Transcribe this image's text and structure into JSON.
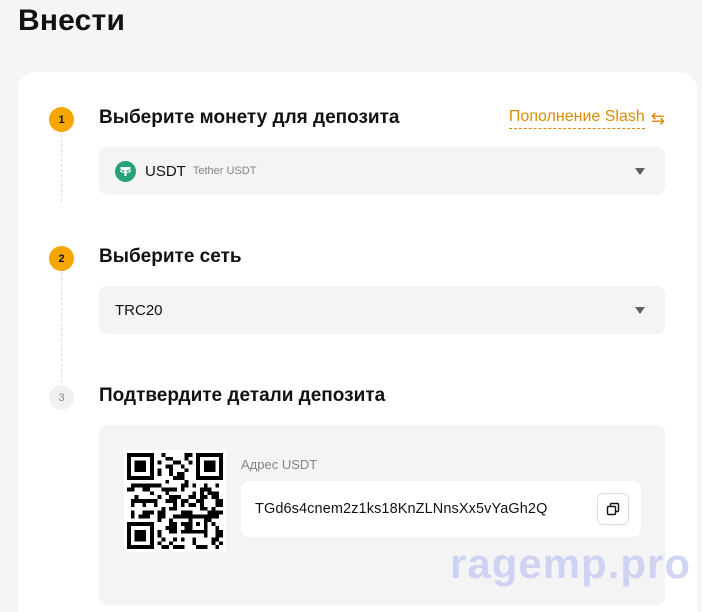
{
  "page": {
    "title": "Внести"
  },
  "steps": [
    {
      "number": "1",
      "title": "Выберите монету для депозита"
    },
    {
      "number": "2",
      "title": "Выберите сеть"
    },
    {
      "number": "3",
      "title": "Подтвердите детали депозита"
    }
  ],
  "switch_link": {
    "label": "Пополнение Slash",
    "icon": "swap-arrows-icon"
  },
  "coin_select": {
    "symbol": "USDT",
    "name": "Tether USDT",
    "icon": "tether-icon",
    "icon_color": "#26a17b"
  },
  "network_select": {
    "value": "TRC20"
  },
  "deposit": {
    "address_label": "Адрес USDT",
    "address": "TGd6s4cnem2z1ks18KnZLNnsXx5vYaGh2Q",
    "copy_icon": "copy-icon"
  },
  "watermark": {
    "text": "ragemp.pro"
  },
  "colors": {
    "accent": "#f7a600",
    "link": "#d98c00"
  }
}
